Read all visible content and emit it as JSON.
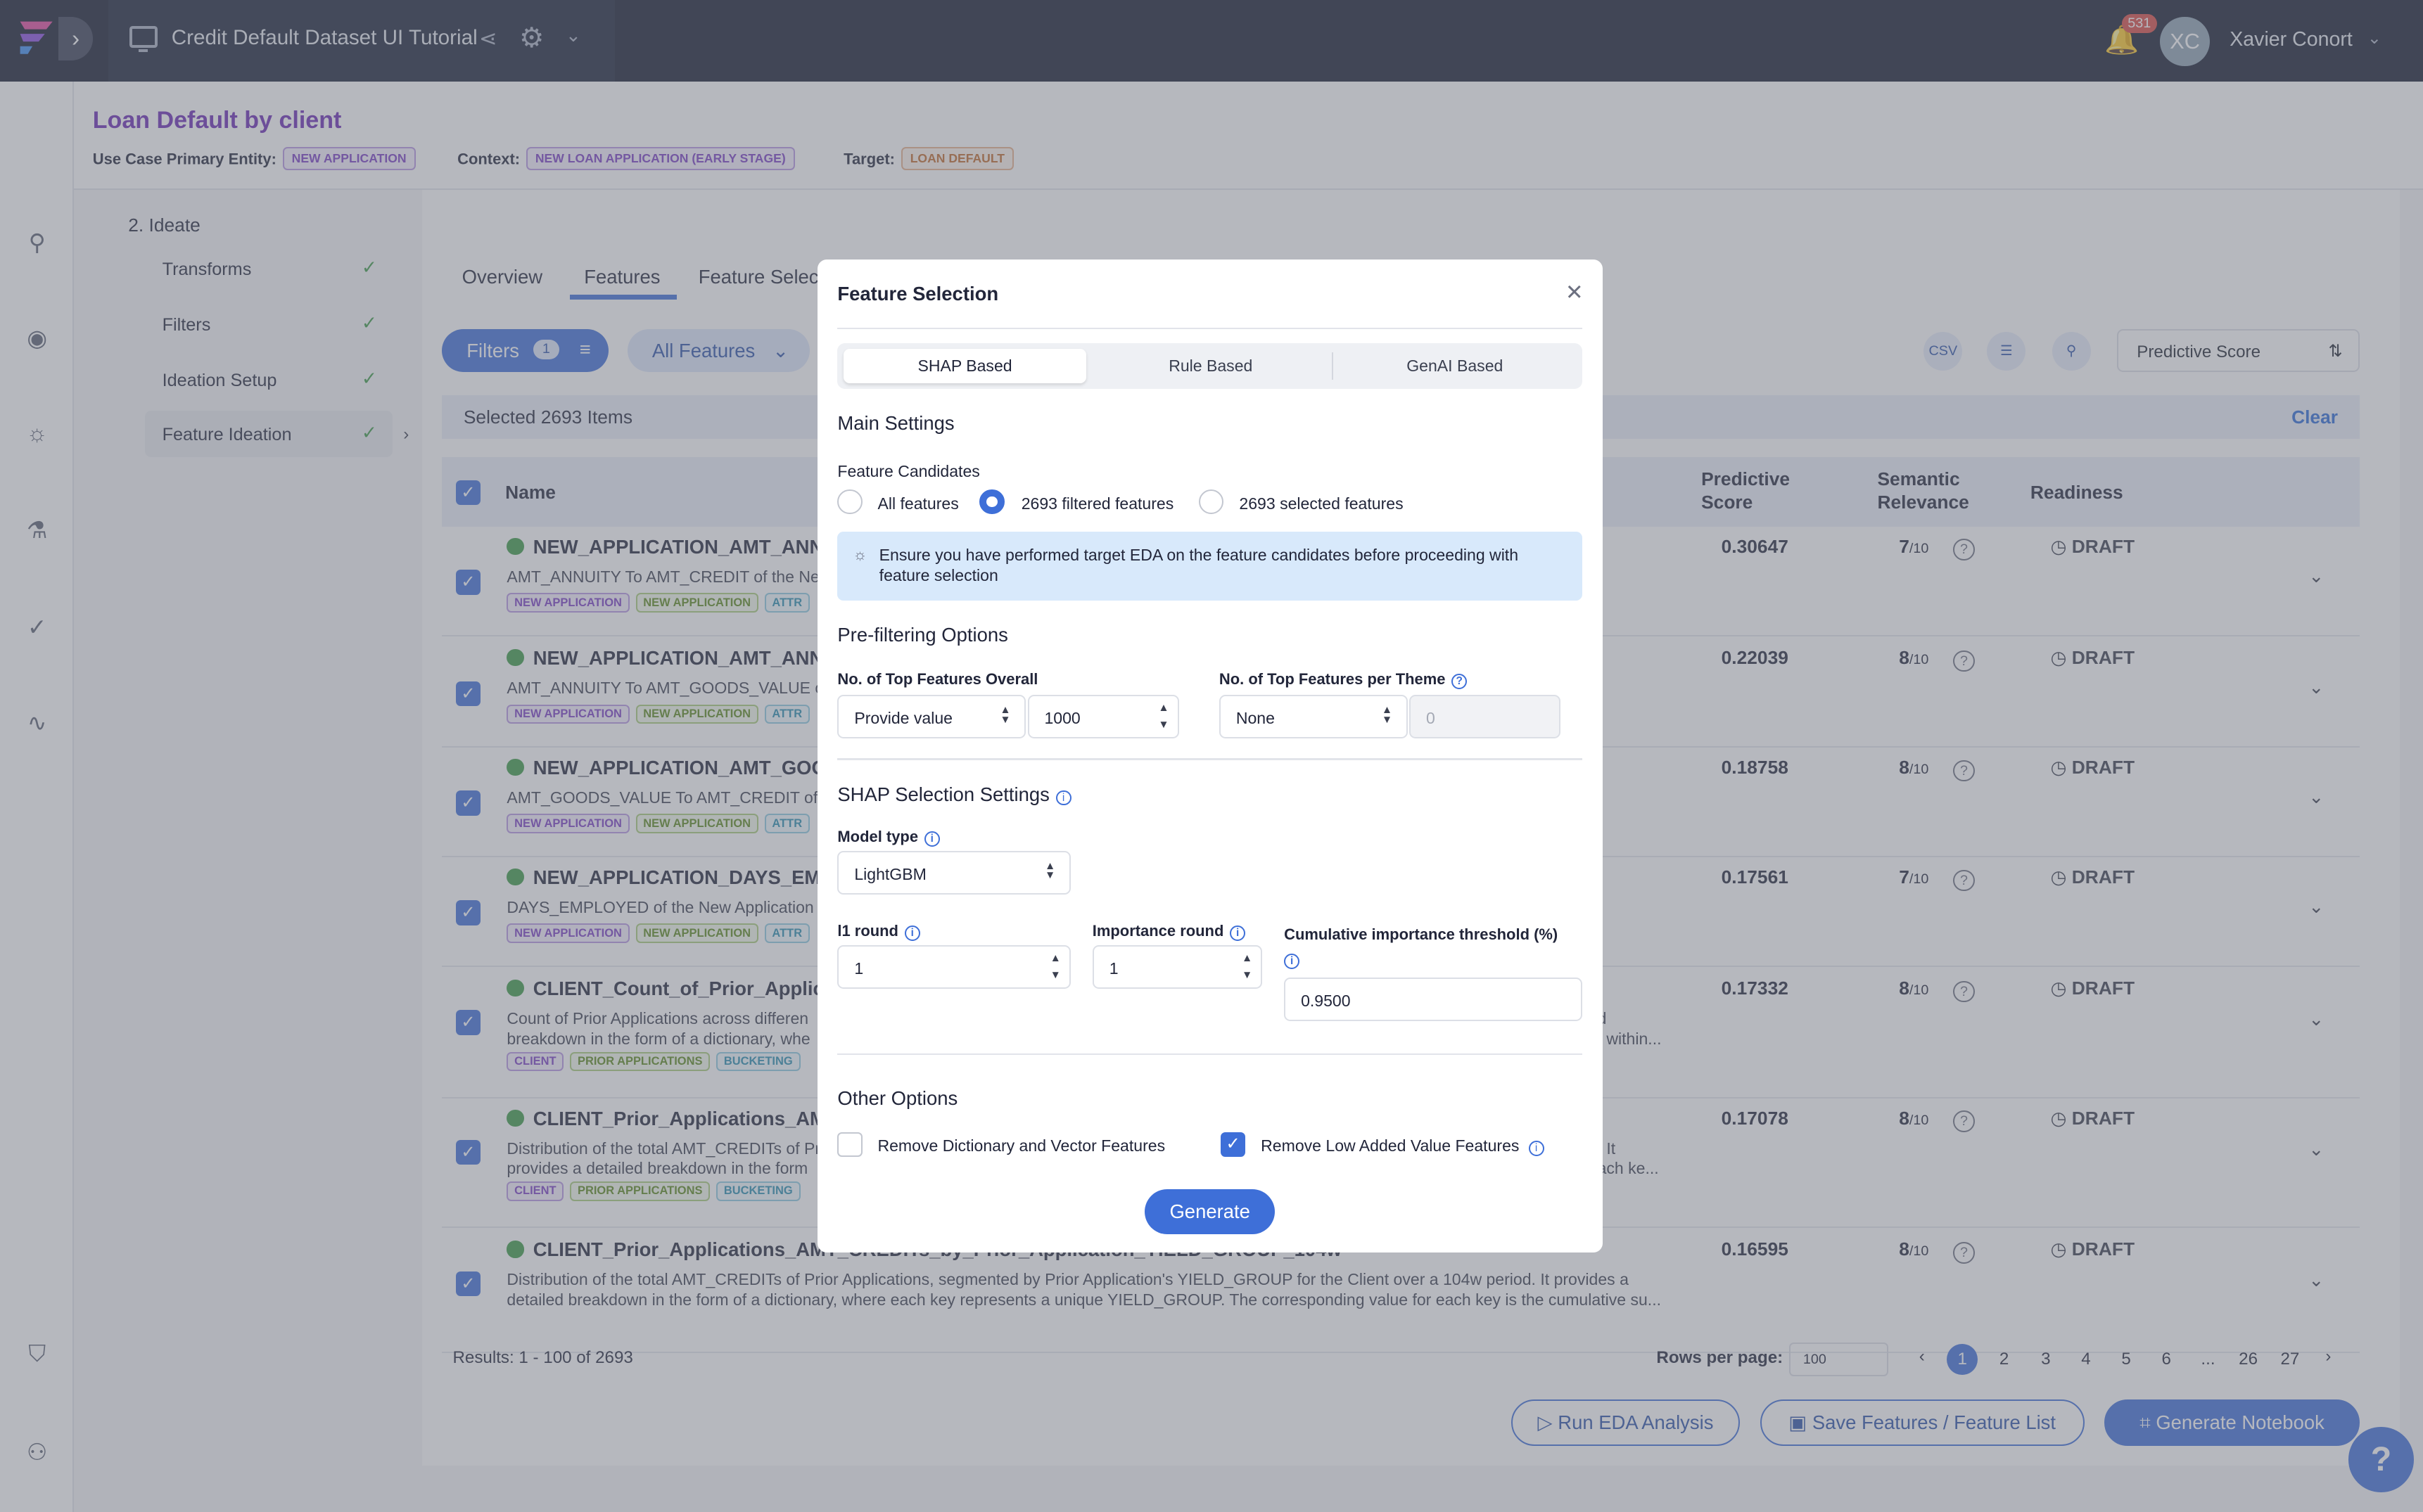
{
  "topbar": {
    "app_title": "Credit Default Dataset UI Tutorial",
    "notifications": "531",
    "avatar_initials": "XC",
    "user_name": "Xavier Conort"
  },
  "header": {
    "use_case_title": "Loan Default by client",
    "primary_entity_label": "Use Case Primary Entity:",
    "primary_entity": "NEW APPLICATION",
    "context_label": "Context:",
    "context": "NEW LOAN APPLICATION (EARLY STAGE)",
    "target_label": "Target:",
    "target": "LOAN DEFAULT"
  },
  "sidebar": {
    "section": "2. Ideate",
    "items": [
      {
        "label": "Transforms"
      },
      {
        "label": "Filters"
      },
      {
        "label": "Ideation Setup"
      },
      {
        "label": "Feature Ideation"
      }
    ]
  },
  "main": {
    "tabs": [
      "Overview",
      "Features",
      "Feature Select"
    ],
    "filters_label": "Filters",
    "filters_count": "1",
    "all_features_label": "All Features",
    "sort_label": "Predictive Score",
    "selected_text": "Selected 2693 Items",
    "clear_label": "Clear",
    "columns": {
      "name": "Name",
      "score": "Predictive Score",
      "relevance": "Semantic Relevance",
      "readiness": "Readiness"
    },
    "rows": [
      {
        "name": "NEW_APPLICATION_AMT_ANNUI",
        "desc": "AMT_ANNUITY To AMT_CREDIT of the New",
        "tags": [
          "NEW APPLICATION",
          "NEW APPLICATION",
          "ATTR"
        ],
        "score": "0.30647",
        "rel": "7",
        "status": "DRAFT"
      },
      {
        "name": "NEW_APPLICATION_AMT_ANNUI",
        "desc": "AMT_ANNUITY To AMT_GOODS_VALUE of",
        "tags": [
          "NEW APPLICATION",
          "NEW APPLICATION",
          "ATTR"
        ],
        "score": "0.22039",
        "rel": "8",
        "status": "DRAFT"
      },
      {
        "name": "NEW_APPLICATION_AMT_GOODS",
        "desc": "AMT_GOODS_VALUE To AMT_CREDIT of th",
        "tags": [
          "NEW APPLICATION",
          "NEW APPLICATION",
          "ATTR"
        ],
        "score": "0.18758",
        "rel": "8",
        "status": "DRAFT"
      },
      {
        "name": "NEW_APPLICATION_DAYS_EMPL",
        "desc": "DAYS_EMPLOYED of the New Application",
        "tags": [
          "NEW APPLICATION",
          "NEW APPLICATION",
          "ATTR"
        ],
        "score": "0.17561",
        "rel": "7",
        "status": "DRAFT"
      },
      {
        "name": "CLIENT_Count_of_Prior_Applicati",
        "desc": "Count of Prior Applications across differen",
        "desc2": "breakdown in the form of a dictionary, whe",
        "desc_right": "ed",
        "desc_right2": "nt within...",
        "tags": [
          "CLIENT",
          "PRIOR APPLICATIONS",
          "BUCKETING"
        ],
        "score": "0.17332",
        "rel": "8",
        "status": "DRAFT"
      },
      {
        "name": "CLIENT_Prior_Applications_AMT_",
        "desc": "Distribution of the total AMT_CREDITs of Pr",
        "desc2": "provides a detailed breakdown in the form",
        "desc_right": "d. It",
        "desc_right2": "each ke...",
        "tags": [
          "CLIENT",
          "PRIOR APPLICATIONS",
          "BUCKETING"
        ],
        "score": "0.17078",
        "rel": "8",
        "status": "DRAFT"
      },
      {
        "name": "CLIENT_Prior_Applications_AMT_CREDITs_by_Prior_Application_YIELD_GROUP_104w",
        "desc": "Distribution of the total AMT_CREDITs of Prior Applications, segmented by Prior Application's YIELD_GROUP for the Client over a 104w period. It provides a",
        "desc2": "detailed breakdown in the form of a dictionary, where each key represents a unique YIELD_GROUP. The corresponding value for each key is the cumulative su...",
        "tags": [],
        "score": "0.16595",
        "rel": "8",
        "status": "DRAFT"
      }
    ],
    "rel_denominator": "/10",
    "results_text": "Results: 1 - 100 of 2693",
    "rows_per_page_label": "Rows per page:",
    "rows_per_page": "100",
    "pages": [
      "1",
      "2",
      "3",
      "4",
      "5",
      "6",
      "...",
      "26",
      "27"
    ],
    "actions": {
      "eda": "Run EDA Analysis",
      "save": "Save Features / Feature List",
      "notebook": "Generate Notebook"
    }
  },
  "modal": {
    "title": "Feature Selection",
    "tabs": [
      "SHAP Based",
      "Rule Based",
      "GenAI Based"
    ],
    "main_settings": "Main Settings",
    "candidates_label": "Feature Candidates",
    "candidates": [
      "All features",
      "2693 filtered features",
      "2693 selected features"
    ],
    "info": "Ensure you have performed target EDA on the feature candidates before proceeding with feature selection",
    "prefilter": "Pre-filtering Options",
    "top_overall_label": "No. of Top Features Overall",
    "top_overall_mode": "Provide value",
    "top_overall_value": "1000",
    "top_theme_label": "No. of Top Features per Theme",
    "top_theme_mode": "None",
    "top_theme_value": "0",
    "shap_settings": "SHAP Selection Settings",
    "model_type_label": "Model type",
    "model_type": "LightGBM",
    "l1_label": "l1 round",
    "l1_value": "1",
    "imp_label": "Importance round",
    "imp_value": "1",
    "cum_label": "Cumulative importance threshold (%)",
    "cum_value": "0.9500",
    "other": "Other Options",
    "opt_dict": "Remove Dictionary and Vector Features",
    "opt_low": "Remove Low Added Value Features",
    "generate": "Generate"
  }
}
